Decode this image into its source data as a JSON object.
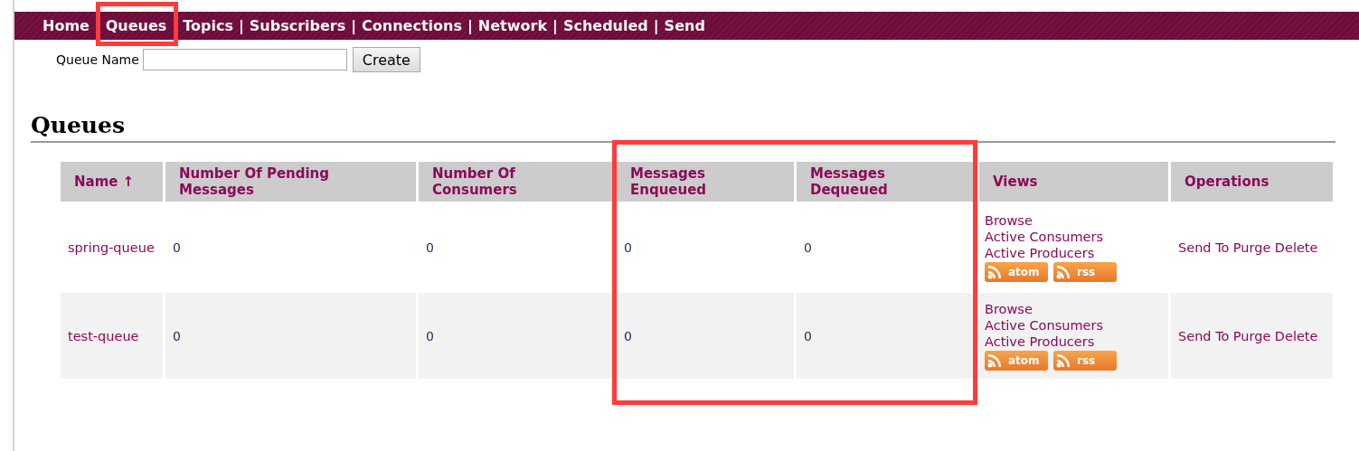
{
  "nav": [
    {
      "label": "Home"
    },
    {
      "label": "Queues"
    },
    {
      "label": "Topics"
    },
    {
      "label": "Subscribers"
    },
    {
      "label": "Connections"
    },
    {
      "label": "Network"
    },
    {
      "label": "Scheduled"
    },
    {
      "label": "Send"
    }
  ],
  "separator": "|",
  "create_form": {
    "label": "Queue Name",
    "button": "Create"
  },
  "heading": "Queues",
  "table": {
    "columns": [
      "Name ↑",
      "Number Of Pending Messages",
      "Number Of Consumers",
      "Messages Enqueued",
      "Messages Dequeued",
      "Views",
      "Operations"
    ],
    "rows": [
      {
        "name": "spring-queue",
        "pending": "0",
        "consumers": "0",
        "enqueued": "0",
        "dequeued": "0",
        "views": [
          "Browse",
          "Active Consumers",
          "Active Producers"
        ],
        "feeds": [
          "atom",
          "rss"
        ],
        "operations": [
          "Send To",
          "Purge",
          "Delete"
        ]
      },
      {
        "name": "test-queue",
        "pending": "0",
        "consumers": "0",
        "enqueued": "0",
        "dequeued": "0",
        "views": [
          "Browse",
          "Active Consumers",
          "Active Producers"
        ],
        "feeds": [
          "atom",
          "rss"
        ],
        "operations": [
          "Send To",
          "Purge",
          "Delete"
        ]
      }
    ]
  },
  "annotation_frames": [
    {
      "color": "#ff3b3b"
    },
    {
      "color": "#ff3b3b"
    }
  ]
}
